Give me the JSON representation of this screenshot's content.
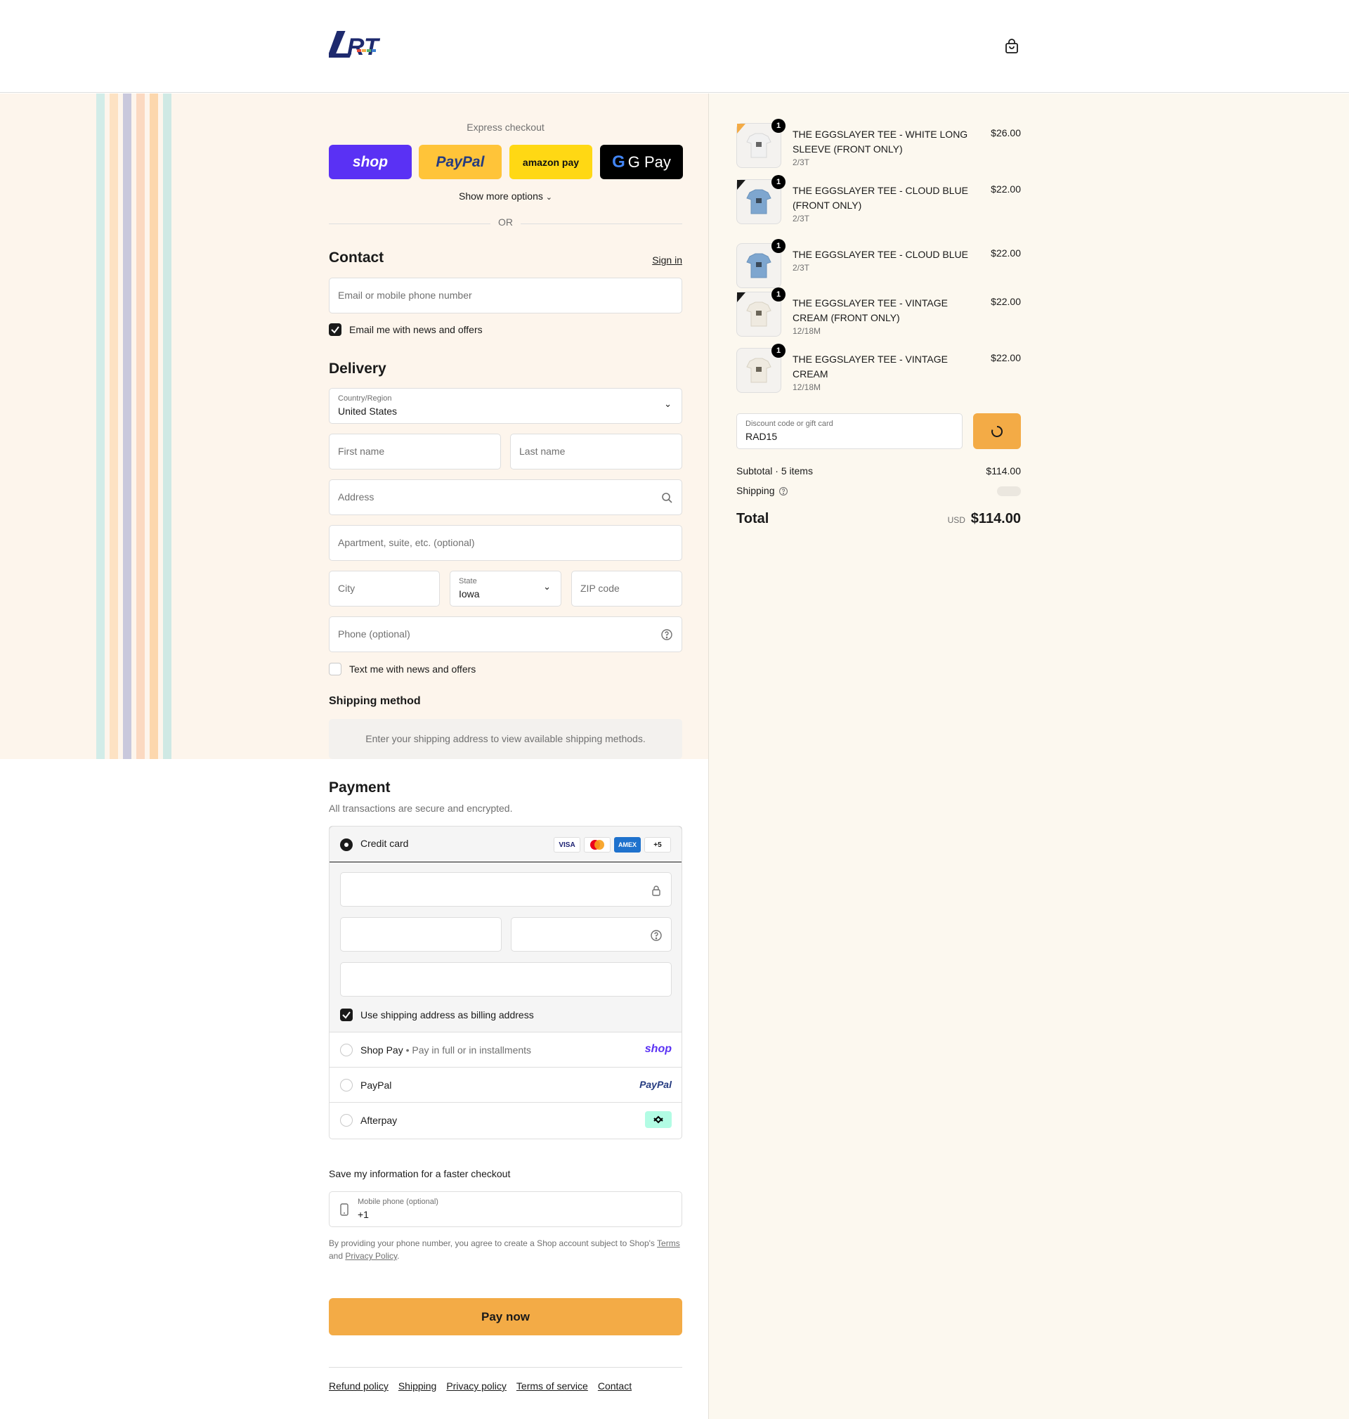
{
  "header": {
    "logo_text": "LRT"
  },
  "express": {
    "title": "Express checkout",
    "buttons": [
      {
        "label": "shop",
        "bg": "#5a31f4",
        "color": "#ffffff"
      },
      {
        "label": "PayPal",
        "bg": "#ffc439",
        "color": "#253b80"
      },
      {
        "label": "amazon pay",
        "bg": "#ffd814",
        "color": "#0f1111"
      },
      {
        "label": "G Pay",
        "bg": "#000000",
        "color": "#ffffff"
      }
    ],
    "more_options": "Show more options",
    "or": "OR"
  },
  "contact": {
    "title": "Contact",
    "sign_in": "Sign in",
    "email_placeholder": "Email or mobile phone number",
    "news_label": "Email me with news and offers"
  },
  "delivery": {
    "title": "Delivery",
    "country_label": "Country/Region",
    "country_value": "United States",
    "first_name": "First name",
    "last_name": "Last name",
    "address": "Address",
    "apartment": "Apartment, suite, etc. (optional)",
    "city": "City",
    "state_label": "State",
    "state_value": "Iowa",
    "zip": "ZIP code",
    "phone": "Phone (optional)",
    "text_label": "Text me with news and offers"
  },
  "shipping_method": {
    "title": "Shipping method",
    "message": "Enter your shipping address to view available shipping methods."
  },
  "payment": {
    "title": "Payment",
    "subtitle": "All transactions are secure and encrypted.",
    "credit_card": "Credit card",
    "card_logos": [
      "VISA",
      "MC",
      "AMEX",
      "+5"
    ],
    "billing_label": "Use shipping address as billing address",
    "shop_pay": "Shop Pay",
    "shop_pay_note": "Pay in full or in installments",
    "shop_pay_logo": "shop",
    "paypal": "PayPal",
    "paypal_logo": "PayPal",
    "afterpay": "Afterpay"
  },
  "save_info": {
    "title": "Save my information for a faster checkout",
    "mobile_label": "Mobile phone (optional)",
    "mobile_value": "+1",
    "legal_prefix": "By providing your phone number, you agree to create a Shop account subject to Shop's",
    "terms": "Terms",
    "and": "and",
    "privacy": "Privacy Policy",
    "period": "."
  },
  "pay_now": "Pay now",
  "footer": [
    "Refund policy",
    "Shipping",
    "Privacy policy",
    "Terms of service",
    "Contact"
  ],
  "cart": {
    "items": [
      {
        "qty": "1",
        "title": "THE EGGSLAYER TEE - WHITE LONG SLEEVE (FRONT ONLY)",
        "variant": "2/3T",
        "price": "$26.00",
        "shirt": "#f1f1f1"
      },
      {
        "qty": "1",
        "title": "THE EGGSLAYER TEE - CLOUD BLUE (FRONT ONLY)",
        "variant": "2/3T",
        "price": "$22.00",
        "shirt": "#7ea6cf"
      },
      {
        "qty": "1",
        "title": "THE EGGSLAYER TEE - CLOUD BLUE",
        "variant": "2/3T",
        "price": "$22.00",
        "shirt": "#7ea6cf"
      },
      {
        "qty": "1",
        "title": "THE EGGSLAYER TEE - VINTAGE CREAM (FRONT ONLY)",
        "variant": "12/18M",
        "price": "$22.00",
        "shirt": "#efeae0"
      },
      {
        "qty": "1",
        "title": "THE EGGSLAYER TEE - VINTAGE CREAM",
        "variant": "12/18M",
        "price": "$22.00",
        "shirt": "#efeae0"
      }
    ],
    "discount_label": "Discount code or gift card",
    "discount_value": "RAD15",
    "subtotal_label": "Subtotal · 5 items",
    "subtotal_value": "$114.00",
    "shipping_label": "Shipping",
    "total_label": "Total",
    "currency": "USD",
    "total_value": "$114.00"
  },
  "colors": {
    "accent": "#f3ab46",
    "left_bg": "#fdf5ec",
    "right_bg": "#fcf8ef"
  }
}
